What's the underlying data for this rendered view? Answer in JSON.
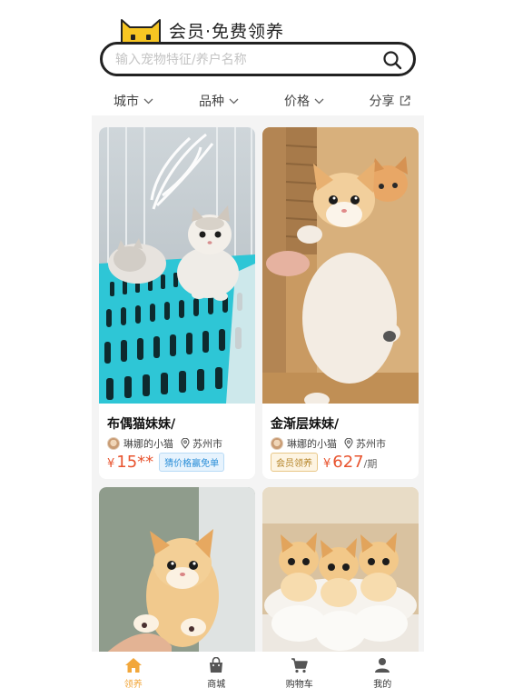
{
  "header": {
    "slogan": "会员·免费领养",
    "search_placeholder": "输入宠物特征/养户名称"
  },
  "filters": [
    {
      "label": "城市"
    },
    {
      "label": "品种"
    },
    {
      "label": "价格"
    },
    {
      "label": "分享"
    }
  ],
  "cards": [
    {
      "title": "布偶猫妹妹/",
      "seller": "琳娜的小猫",
      "city": "苏州市",
      "currency": "¥",
      "price": "15**",
      "tag": "猜价格赢免单"
    },
    {
      "title": "金渐层妹妹/",
      "seller": "琳娜的小猫",
      "city": "苏州市",
      "currency": "¥",
      "price": "627",
      "unit": "/期",
      "tag": "会员领养"
    }
  ],
  "tabbar": [
    {
      "label": "领养",
      "icon": "home-icon",
      "active": true
    },
    {
      "label": "商城",
      "icon": "shop-bag-icon"
    },
    {
      "label": "购物车",
      "icon": "cart-icon"
    },
    {
      "label": "我的",
      "icon": "user-icon"
    }
  ],
  "colors": {
    "accent": "#f2a73b",
    "price": "#e8542f",
    "tag_blue": "#2a8ed8",
    "tag_gold": "#b58428"
  }
}
